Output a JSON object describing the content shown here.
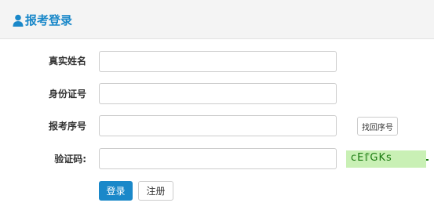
{
  "header": {
    "title": "报考登录",
    "icon": "user-icon"
  },
  "form": {
    "name_label": "真实姓名",
    "id_label": "身份证号",
    "seq_label": "报考序号",
    "captcha_label": "验证码:",
    "name_value": "",
    "id_value": "",
    "seq_value": "",
    "captcha_value": ""
  },
  "buttons": {
    "find_seq": "找回序号",
    "login": "登录",
    "register": "注册"
  },
  "captcha": {
    "text": "cE𝕗GKs"
  },
  "colors": {
    "accent": "#1a88c9",
    "captcha_bg": "#c9f0b5",
    "captcha_text": "#1a7a10"
  }
}
